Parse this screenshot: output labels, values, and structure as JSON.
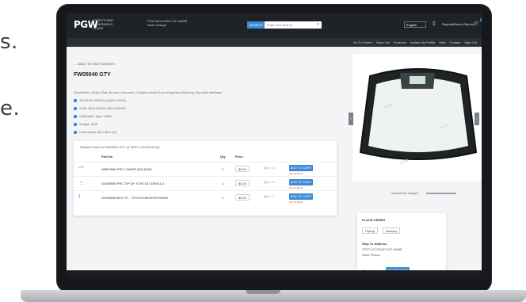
{
  "slide": {
    "text_top": "s.",
    "text_mid": "e."
  },
  "header": {
    "logo": "PGW",
    "logo_sub": "EVERYTHING WINDSHIELD GLASS",
    "account": "PGW ACCOUNT A/C NAME",
    "account_sub": "Store change",
    "search_button": "SEARCH",
    "search_placeholder": "Enter Part Search",
    "language": "English",
    "reports": "Reports",
    "returns": "Return Returns",
    "cart_count": "2"
  },
  "nav": {
    "items": [
      "Go To Orders",
      "Store List",
      "Products",
      "Update My Profile",
      "Help",
      "Contact",
      "Sign Out"
    ]
  },
  "main": {
    "back": "← BACK TO PART SEARCH",
    "title": "FW05040 GTY",
    "spec": "Windshield | Solar | Rain Sensor | Acoustic | Collision Avoid | Lane Departure Warning | Acoustic Interlayer",
    "attributes": [
      "TOYOTA COROLLA (2014-2019)",
      "OEM: 5610102H10 5610102H20",
      "Calibration Type: Static",
      "Weight: 28 lb",
      "Dimensions: 58 x 38 in (H)"
    ],
    "related_title": "Related Parts for FW05040 GTY at TEST LOCATION (2)",
    "columns": {
      "part": "Part No",
      "qty": "Qty",
      "price": "Price"
    },
    "rows": [
      {
        "part": "WMP4980 PRC LOWER MOLDING",
        "qty": "1",
        "price": "$0.00",
        "stock": "Out Of Stock"
      },
      {
        "part": "DOW5056 PRC TIP UP TOYOTA COROLLA",
        "qty": "1",
        "price": "$0.00",
        "stock": "Out Of Stock"
      },
      {
        "part": "DOW5056 BLK PC - TOYOTA BROKER MODE",
        "qty": "1",
        "price": "$0.00",
        "stock": "Out Of Stock"
      }
    ],
    "add_to_cart": "ADD TO CART"
  },
  "right": {
    "thumbs_caption": "Windshield Images",
    "order_title": "PLACE ORDER",
    "order_pickup": "Pickup",
    "order_delivery": "Delivery",
    "order_line1": "Ship To Address",
    "order_line2": "TEST ACCOUNT A/C NAME",
    "order_line3": "Store Pickup",
    "qty_label": "Qty",
    "add_to_cart": "ADD TO CART"
  }
}
